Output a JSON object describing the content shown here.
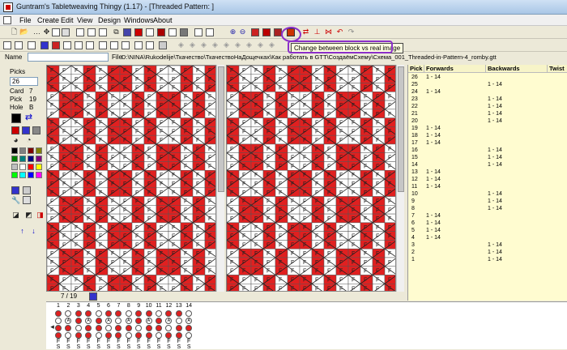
{
  "window": {
    "title": "Guntram's Tabletweaving Thingy (1.17) - [Threaded Pattern: ]"
  },
  "menu": [
    "File",
    "Create",
    "Edit",
    "View",
    "Design",
    "Windows",
    "About"
  ],
  "name_label": "Name",
  "file_label": "File",
  "file_path": "D:\\NINA\\Rukodelije\\Ткачество\\ТкачествоНаДощечках\\Как работать в GTT\\СоздаёмСхему\\Схема_001_Threaded-in-Pattern-4_romby.gtt",
  "tooltip": "Change between block vs real image",
  "left": {
    "picks_label": "Picks",
    "picks_value": "26",
    "card_label": "Card",
    "card_value": "7",
    "pick_label": "Pick",
    "pick_value": "19",
    "hole_label": "Hole",
    "hole_value": "B"
  },
  "palette_colors": [
    "#000000",
    "#808080",
    "#800000",
    "#808000",
    "#008000",
    "#008080",
    "#000080",
    "#800080",
    "#c0c0c0",
    "#ffffff",
    "#ff0000",
    "#ffff00",
    "#00ff00",
    "#00ffff",
    "#0000ff",
    "#ff00ff"
  ],
  "status": {
    "position": "7 / 19"
  },
  "pick_table": {
    "headers": [
      "Pick",
      "Forwards",
      "Backwards",
      "Twist"
    ],
    "rows": [
      {
        "pick": "26",
        "fwd": "1 - 14",
        "bwd": ""
      },
      {
        "pick": "25",
        "fwd": "",
        "bwd": "1 - 14"
      },
      {
        "pick": "24",
        "fwd": "1 - 14",
        "bwd": ""
      },
      {
        "pick": "23",
        "fwd": "",
        "bwd": "1 - 14"
      },
      {
        "pick": "22",
        "fwd": "",
        "bwd": "1 - 14"
      },
      {
        "pick": "21",
        "fwd": "",
        "bwd": "1 - 14"
      },
      {
        "pick": "20",
        "fwd": "",
        "bwd": "1 - 14"
      },
      {
        "pick": "19",
        "fwd": "1 - 14",
        "bwd": ""
      },
      {
        "pick": "18",
        "fwd": "1 - 14",
        "bwd": ""
      },
      {
        "pick": "17",
        "fwd": "1 - 14",
        "bwd": ""
      },
      {
        "pick": "16",
        "fwd": "",
        "bwd": "1 - 14"
      },
      {
        "pick": "15",
        "fwd": "",
        "bwd": "1 - 14"
      },
      {
        "pick": "14",
        "fwd": "",
        "bwd": "1 - 14"
      },
      {
        "pick": "13",
        "fwd": "1 - 14",
        "bwd": ""
      },
      {
        "pick": "12",
        "fwd": "1 - 14",
        "bwd": ""
      },
      {
        "pick": "11",
        "fwd": "1 - 14",
        "bwd": ""
      },
      {
        "pick": "10",
        "fwd": "",
        "bwd": "1 - 14"
      },
      {
        "pick": "9",
        "fwd": "",
        "bwd": "1 - 14"
      },
      {
        "pick": "8",
        "fwd": "",
        "bwd": "1 - 14"
      },
      {
        "pick": "7",
        "fwd": "1 - 14",
        "bwd": ""
      },
      {
        "pick": "6",
        "fwd": "1 - 14",
        "bwd": ""
      },
      {
        "pick": "5",
        "fwd": "1 - 14",
        "bwd": ""
      },
      {
        "pick": "4",
        "fwd": "1 - 14",
        "bwd": ""
      },
      {
        "pick": "3",
        "fwd": "",
        "bwd": "1 - 14"
      },
      {
        "pick": "2",
        "fwd": "",
        "bwd": "1 - 14"
      },
      {
        "pick": "1",
        "fwd": "",
        "bwd": "1 - 14"
      }
    ]
  },
  "cards": {
    "numbers": [
      "1",
      "2",
      "3",
      "4",
      "5",
      "6",
      "7",
      "8",
      "9",
      "10",
      "11",
      "12",
      "13",
      "14"
    ],
    "circles": [
      "A",
      "B",
      "C",
      "D"
    ],
    "circle_colors": {
      "red": "#e02020",
      "white": "#ffffff"
    },
    "threading": [
      "S",
      "S",
      "S",
      "S",
      "S",
      "S",
      "S",
      "S",
      "S",
      "S",
      "S",
      "S",
      "S",
      "S"
    ],
    "direction": [
      "F",
      "F",
      "F",
      "F",
      "F",
      "F",
      "F",
      "F",
      "F",
      "F",
      "F",
      "F",
      "F",
      "F"
    ],
    "cell_label": "F",
    "selected_circle": "A"
  }
}
